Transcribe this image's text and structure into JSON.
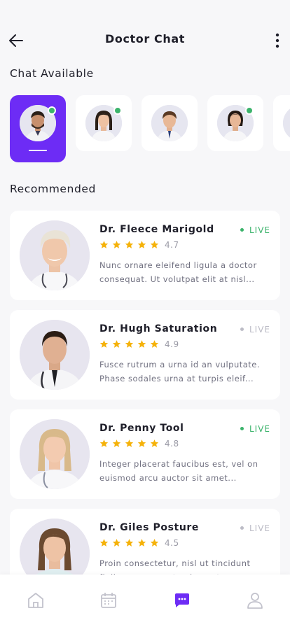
{
  "header": {
    "title": "Doctor Chat"
  },
  "sections": {
    "available": "Chat Available",
    "recommended": "Recommended"
  },
  "colors": {
    "accent": "#6d2cf5",
    "online": "#3bb36b",
    "star": "#f5b20a",
    "offline": "#bcbcc6"
  },
  "chat_available": [
    {
      "online": true,
      "active": true
    },
    {
      "online": true,
      "active": false
    },
    {
      "online": false,
      "active": false
    },
    {
      "online": true,
      "active": false
    },
    {
      "online": false,
      "active": false
    }
  ],
  "doctors": [
    {
      "name": "Dr. Fleece Marigold",
      "live_label": "LIVE",
      "live": true,
      "stars": 5,
      "rating": "4.7",
      "desc_line1": "Nunc ornare eleifend ligula a doctor",
      "desc_line2": "consequat. Ut volutpat elit at nisl..."
    },
    {
      "name": "Dr. Hugh Saturation",
      "live_label": "LIVE",
      "live": false,
      "stars": 5,
      "rating": "4.9",
      "desc_line1": "Fusce rutrum a urna id an vulputate.",
      "desc_line2": "Phase sodales urna at turpis eleif..."
    },
    {
      "name": "Dr. Penny Tool",
      "live_label": "LIVE",
      "live": true,
      "stars": 5,
      "rating": "4.8",
      "desc_line1": "Integer placerat faucibus est, vel on",
      "desc_line2": "euismod arcu auctor sit amet..."
    },
    {
      "name": "Dr. Giles Posture",
      "live_label": "LIVE",
      "live": false,
      "stars": 5,
      "rating": "4.5",
      "desc_line1": "Proin consectetur, nisl ut tincidunt",
      "desc_line2": "finibus, purus ante elementum"
    }
  ],
  "tabbar": {
    "active": "chat"
  }
}
